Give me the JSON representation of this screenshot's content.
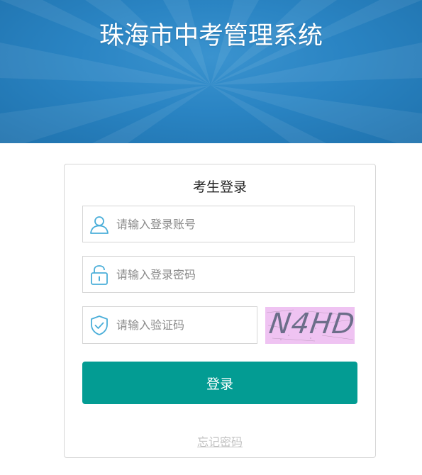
{
  "header": {
    "title": "珠海市中考管理系统"
  },
  "login": {
    "title": "考生登录",
    "account_placeholder": "请输入登录账号",
    "password_placeholder": "请输入登录密码",
    "captcha_placeholder": "请输入验证码",
    "captcha_text": "N4HD",
    "submit_label": "登录",
    "forgot_label": "忘记密码"
  },
  "colors": {
    "banner": "#2a84c3",
    "accent": "#039c93",
    "icon": "#4aaed9",
    "captcha_bg": "#efc3f2"
  },
  "icons": {
    "account": "user-icon",
    "password": "lock-icon",
    "captcha": "shield-check-icon"
  }
}
